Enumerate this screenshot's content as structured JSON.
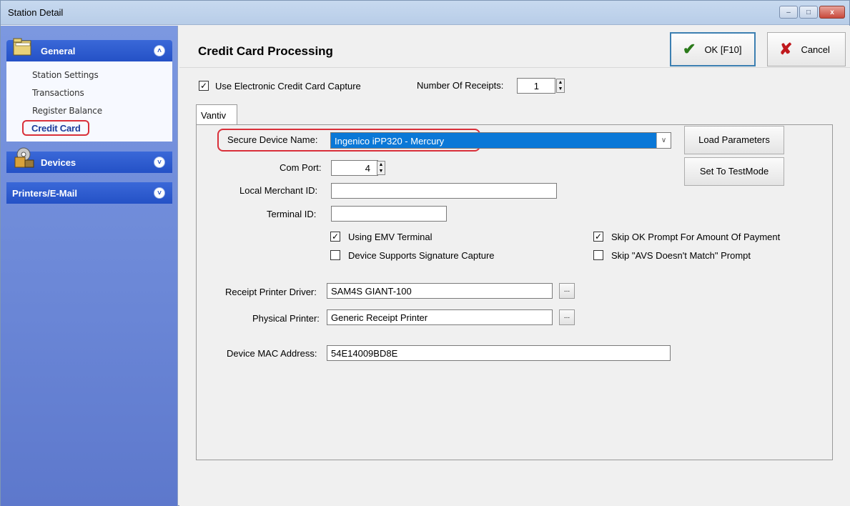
{
  "window": {
    "title": "Station Detail",
    "min": "–",
    "max": "□",
    "close": "x"
  },
  "sidebar": {
    "general": {
      "label": "General",
      "items": [
        "Station Settings",
        "Transactions",
        "Register Balance",
        "Credit Card"
      ]
    },
    "devices": {
      "label": "Devices"
    },
    "printers": {
      "label": "Printers/E-Mail"
    }
  },
  "header": {
    "title": "Credit Card Processing",
    "ok_label": "OK [F10]",
    "cancel_label": "Cancel"
  },
  "form": {
    "use_ecc_label": "Use Electronic Credit Card Capture",
    "use_ecc_checked": true,
    "num_receipts_label": "Number Of Receipts:",
    "num_receipts_value": "1",
    "tab_label": "Vantiv",
    "secure_device_label": "Secure Device Name:",
    "secure_device_value": "Ingenico iPP320 - Mercury",
    "load_params_label": "Load Parameters",
    "test_mode_label": "Set To TestMode",
    "com_port_label": "Com Port:",
    "com_port_value": "4",
    "merchant_id_label": "Local Merchant ID:",
    "merchant_id_value": "",
    "terminal_id_label": "Terminal ID:",
    "terminal_id_value": "",
    "emv_label": "Using EMV Terminal",
    "emv_checked": true,
    "sig_label": "Device Supports Signature Capture",
    "sig_checked": false,
    "skip_ok_label": "Skip OK Prompt For Amount Of Payment",
    "skip_ok_checked": true,
    "skip_avs_label": "Skip \"AVS Doesn't Match\" Prompt",
    "skip_avs_checked": false,
    "receipt_driver_label": "Receipt Printer Driver:",
    "receipt_driver_value": "SAM4S GIANT-100",
    "physical_printer_label": "Physical Printer:",
    "physical_printer_value": "Generic Receipt Printer",
    "mac_label": "Device MAC Address:",
    "mac_value": "54E14009BD8E",
    "ellipsis": "..."
  },
  "icons": {
    "check": "✓",
    "ok_icon": "✔",
    "cancel_icon": "✘",
    "chev_up": "˄",
    "chev_down": "˅",
    "dropdown": "∨",
    "spin_up": "▲",
    "spin_down": "▼"
  },
  "colors": {
    "sidebar_header": "#2451c6",
    "highlight": "#d9303a",
    "selection": "#0a78d7"
  }
}
